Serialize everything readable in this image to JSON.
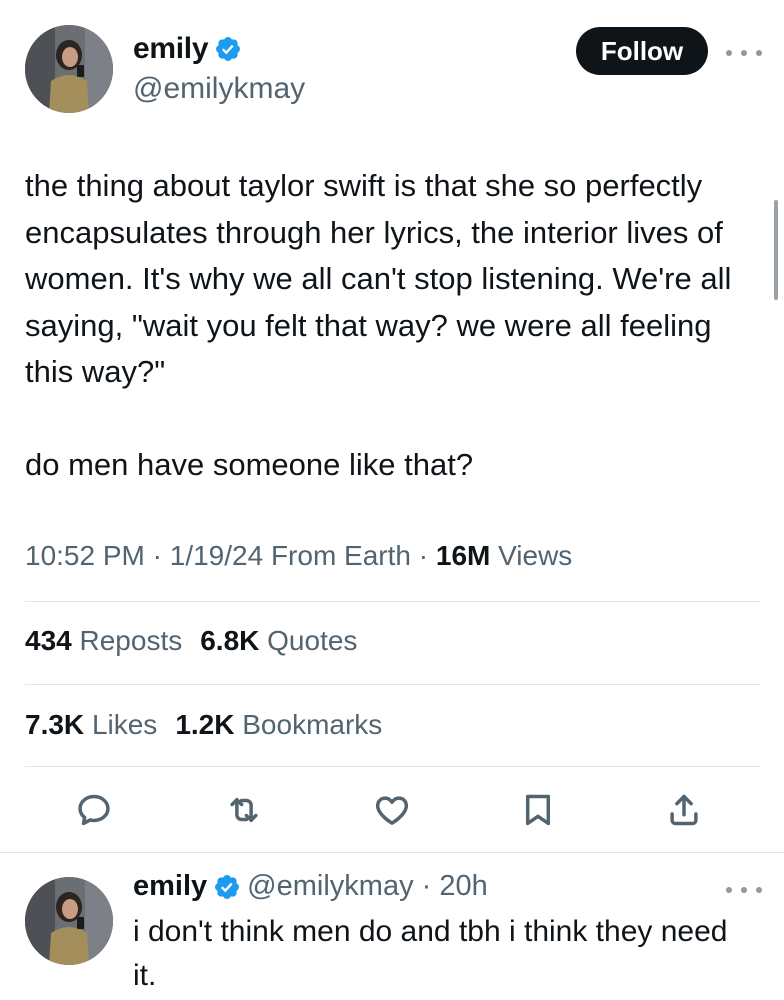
{
  "tweet": {
    "author": {
      "display_name": "emily",
      "handle": "@emilykmay",
      "verified_icon": "verified-badge-icon"
    },
    "follow_label": "Follow",
    "text": "the thing about taylor swift is that she so perfectly encapsulates through her lyrics, the interior lives of women. It's why we all can't stop listening. We're all saying, \"wait you felt that way? we were all feeling this way?\"\n\ndo men have someone like that?",
    "meta": {
      "time": "10:52 PM",
      "sep1": " · ",
      "date": "1/19/24",
      "source": " From Earth",
      "sep2": " · ",
      "views_count": "16M",
      "views_label": " Views"
    },
    "stats": {
      "reposts_count": "434",
      "reposts_label": "Reposts",
      "quotes_count": "6.8K",
      "quotes_label": "Quotes",
      "likes_count": "7.3K",
      "likes_label": "Likes",
      "bookmarks_count": "1.2K",
      "bookmarks_label": "Bookmarks"
    },
    "actions": [
      "reply-icon",
      "repost-icon",
      "like-icon",
      "bookmark-icon",
      "share-icon"
    ]
  },
  "reply": {
    "display_name": "emily",
    "handle_time": "@emilykmay · 20h",
    "text": "i don't think men do and tbh i think they need it."
  },
  "colors": {
    "primary_text": "#0f1419",
    "secondary_text": "#536471",
    "verified_blue": "#1d9bf0",
    "follow_bg": "#0f1419",
    "divider": "#e1e6ea"
  }
}
